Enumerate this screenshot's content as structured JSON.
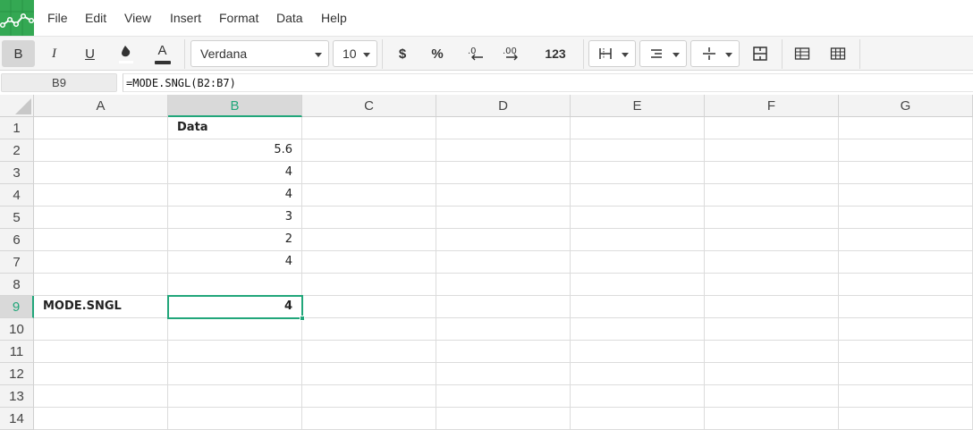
{
  "menu": [
    "File",
    "Edit",
    "View",
    "Insert",
    "Format",
    "Data",
    "Help"
  ],
  "toolbar": {
    "bold": "B",
    "italic": "I",
    "underline": "U",
    "text_color": "A",
    "font": "Verdana",
    "font_size": "10",
    "currency": "$",
    "percent": "%",
    "number_format": "123"
  },
  "formula_bar": {
    "cell_ref": "B9",
    "formula": "=MODE.SNGL(B2:B7)"
  },
  "columns": [
    "A",
    "B",
    "C",
    "D",
    "E",
    "F",
    "G"
  ],
  "selected_column": "B",
  "rows": [
    "1",
    "2",
    "3",
    "4",
    "5",
    "6",
    "7",
    "8",
    "9",
    "10",
    "11",
    "12",
    "13",
    "14"
  ],
  "selected_row": "9",
  "cells": {
    "B1": "Data",
    "B2": "5.6",
    "B3": "4",
    "B4": "4",
    "B5": "3",
    "B6": "2",
    "B7": "4",
    "A9": "MODE.SNGL",
    "B9": "4"
  },
  "colors": {
    "brand": "#34a853",
    "selection": "#21a67a"
  }
}
